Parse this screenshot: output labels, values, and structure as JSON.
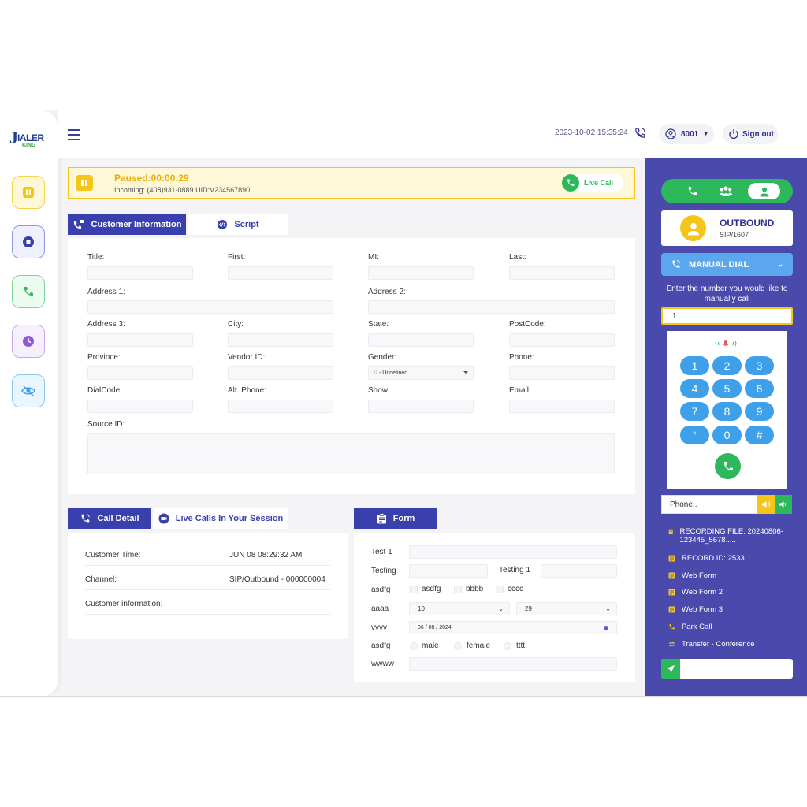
{
  "logo": {
    "letter": "J",
    "word": "IALER",
    "sub": "KING"
  },
  "topbar": {
    "datetime": "2023-10-02  15:35:24",
    "user": "8001",
    "signout": "Sign out"
  },
  "status": {
    "title": "Paused:00:00:29",
    "subtitle": "Incoming: (408)931-0889 UID:V234567890",
    "live_call": "Live Call"
  },
  "tabs": {
    "customer_info": "Customer Information",
    "script": "Script",
    "call_detail": "Call Detail",
    "live_calls": "Live Calls In Your Session",
    "form": "Form"
  },
  "customer_form": {
    "title": "Title:",
    "first": "First:",
    "mi": "MI:",
    "last": "Last:",
    "address1": "Address 1:",
    "address2": "Address 2:",
    "address3": "Address 3:",
    "city": "City:",
    "state": "State:",
    "postcode": "PostCode:",
    "province": "Province:",
    "vendor_id": "Vendor ID:",
    "gender": "Gender:",
    "gender_value": "U - Undefined",
    "phone": "Phone:",
    "dialcode": "DialCode:",
    "alt_phone": "Alt. Phone:",
    "show": "Show:",
    "email": "Email:",
    "source_id": "Source ID:"
  },
  "call_detail": {
    "rows": [
      {
        "label": "Customer Time:",
        "value": "JUN 08 08:29:32 AM"
      },
      {
        "label": "Channel:",
        "value": "SIP/Outbound - 000000004"
      },
      {
        "label": "Customer information:",
        "value": ""
      }
    ]
  },
  "form": {
    "test1": "Test 1",
    "testing": "Testing",
    "testing1": "Testing 1",
    "asdfg1": "asdfg",
    "opt_asdfg": "asdfg",
    "opt_bbbb": "bbbb",
    "opt_cccc": "cccc",
    "aaaa": "aaaa",
    "sel1": "10",
    "sel2": "29",
    "vvvv": "vvvv",
    "date": "06 / 08 / 2024",
    "asdfg2": "asdfg",
    "opt_male": "male",
    "opt_female": "female",
    "opt_tttt": "tttt",
    "wwww": "wwww"
  },
  "right_panel": {
    "direction": "OUTBOUND",
    "sip": "SIP/1607",
    "manual_dial": "MANUAL DIAL",
    "instruction": "Enter the number you would like to manually call",
    "number_value": "1",
    "keys": [
      "1",
      "2",
      "3",
      "4",
      "5",
      "6",
      "7",
      "8",
      "9",
      "*",
      "0",
      "#"
    ],
    "phone_placeholder": "Phone..",
    "links": [
      {
        "text": "RECORDING FILE: 20240806-123445_5678.....",
        "icon": "file-icon"
      },
      {
        "text": "RECORD ID: 2533",
        "icon": "record-icon"
      },
      {
        "text": "Web Form",
        "icon": "form-icon"
      },
      {
        "text": "Web Form 2",
        "icon": "form-icon"
      },
      {
        "text": "Web Form 3",
        "icon": "form-icon"
      },
      {
        "text": "Park Call",
        "icon": "phone-icon"
      },
      {
        "text": "Transfer - Conference",
        "icon": "transfer-icon"
      }
    ]
  },
  "colors": {
    "accent": "#3a3fae",
    "panel": "#4a4aad",
    "yellow": "#f5c518",
    "green": "#2eb85c",
    "blue": "#3ea0e8"
  }
}
